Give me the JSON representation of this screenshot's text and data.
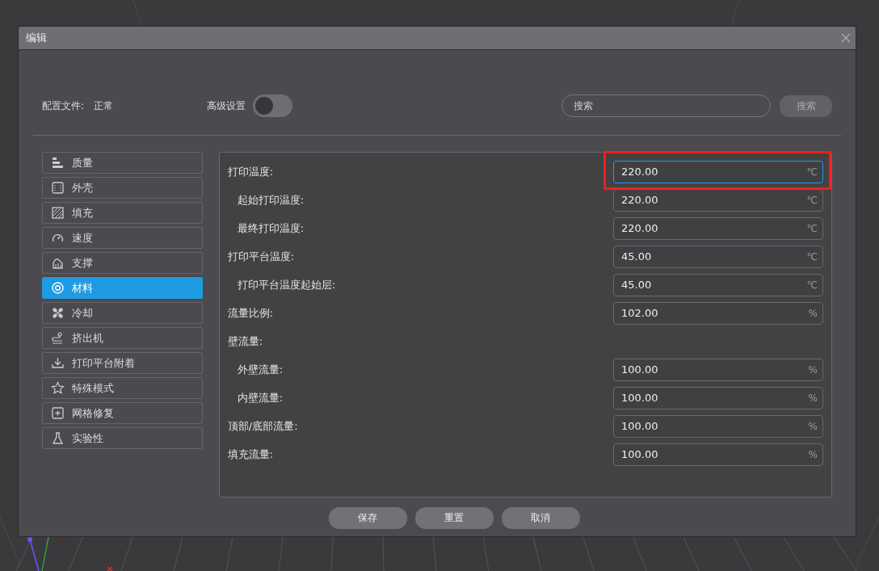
{
  "window": {
    "title": "编辑"
  },
  "profile": {
    "label": "配置文件:",
    "value": "正常"
  },
  "advanced": {
    "label": "高级设置",
    "on": false
  },
  "search": {
    "placeholder": "搜索",
    "button": "搜索"
  },
  "categories": [
    {
      "label": "质量",
      "kind": "quality",
      "selected": false
    },
    {
      "label": "外壳",
      "kind": "shell",
      "selected": false
    },
    {
      "label": "填充",
      "kind": "infill",
      "selected": false
    },
    {
      "label": "速度",
      "kind": "speed",
      "selected": false
    },
    {
      "label": "支撑",
      "kind": "support",
      "selected": false
    },
    {
      "label": "材料",
      "kind": "material",
      "selected": true
    },
    {
      "label": "冷却",
      "kind": "cooling",
      "selected": false
    },
    {
      "label": "挤出机",
      "kind": "extruder",
      "selected": false
    },
    {
      "label": "打印平台附着",
      "kind": "adhesion",
      "selected": false
    },
    {
      "label": "特殊模式",
      "kind": "special",
      "selected": false
    },
    {
      "label": "网格修复",
      "kind": "mesh",
      "selected": false
    },
    {
      "label": "实验性",
      "kind": "experimental",
      "selected": false
    }
  ],
  "settings": [
    {
      "label": "打印温度:",
      "indented": false,
      "value": "220.00",
      "unit": "℃",
      "focused": true,
      "highlighted": true
    },
    {
      "label": "起始打印温度:",
      "indented": true,
      "value": "220.00",
      "unit": "℃",
      "focused": false,
      "highlighted": false
    },
    {
      "label": "最终打印温度:",
      "indented": true,
      "value": "220.00",
      "unit": "℃",
      "focused": false,
      "highlighted": false
    },
    {
      "label": "打印平台温度:",
      "indented": false,
      "value": "45.00",
      "unit": "℃",
      "focused": false,
      "highlighted": false
    },
    {
      "label": "打印平台温度起始层:",
      "indented": true,
      "value": "45.00",
      "unit": "℃",
      "focused": false,
      "highlighted": false
    },
    {
      "label": "流量比例:",
      "indented": false,
      "value": "102.00",
      "unit": "%",
      "focused": false,
      "highlighted": false
    },
    {
      "label": "壁流量:",
      "indented": false
    },
    {
      "label": "外壁流量:",
      "indented": true,
      "value": "100.00",
      "unit": "%",
      "focused": false,
      "highlighted": false
    },
    {
      "label": "内壁流量:",
      "indented": true,
      "value": "100.00",
      "unit": "%",
      "focused": false,
      "highlighted": false
    },
    {
      "label": "顶部/底部流量:",
      "indented": false,
      "value": "100.00",
      "unit": "%",
      "focused": false,
      "highlighted": false
    },
    {
      "label": "填充流量:",
      "indented": false,
      "value": "100.00",
      "unit": "%",
      "focused": false,
      "highlighted": false
    }
  ],
  "buttons": [
    "保存",
    "重置",
    "取消"
  ]
}
